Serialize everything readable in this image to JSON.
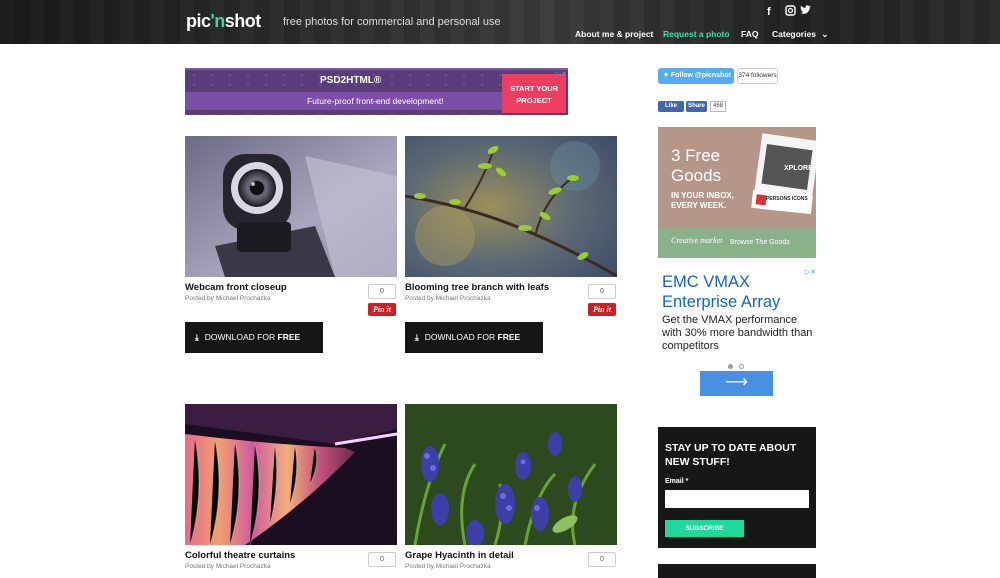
{
  "header": {
    "logo_left": "pic",
    "logo_apos": "'n",
    "logo_right": "shot",
    "tagline": "free photos for commercial and personal use",
    "social": {
      "facebook": "f",
      "instagram": "◘",
      "twitter": "𝕥"
    },
    "nav": [
      {
        "label": "About me & project"
      },
      {
        "label": "Request a photo"
      },
      {
        "label": "FAQ"
      },
      {
        "label": "Categories"
      }
    ],
    "active_color": "#3fe0a8"
  },
  "ad": {
    "brand": "PSD2HTML®",
    "text": "Future-proof front-end development!",
    "cta_line1": "START YOUR",
    "cta_line2": "PROJECT"
  },
  "photos": [
    {
      "title": "Webcam front closeup",
      "by": "Posted by Michael Prochazka",
      "count": "0",
      "pin": "Pin it",
      "download": "DOWNLOAD FOR",
      "download_bold": "FREE"
    },
    {
      "title": "Blooming tree branch with leafs",
      "by": "Posted by Michael Prochazka",
      "count": "0",
      "pin": "Pin it",
      "download": "DOWNLOAD FOR",
      "download_bold": "FREE"
    },
    {
      "title": "Colorful theatre curtains",
      "by": "Posted by Michael Prochazka",
      "count": "0"
    },
    {
      "title": "Grape Hyacinth in detail",
      "by": "Posted by Michael Prochazka",
      "count": "0"
    }
  ],
  "sidebar": {
    "twitter_follow": "Follow @picnshot",
    "twitter_count": "374 followers",
    "fb_like": "Like",
    "fb_share": "Share",
    "fb_count": "468",
    "cm_title_line1": "3 Free",
    "cm_title_line2": "Goods",
    "cm_sub_line1": "IN YOUR INBOX,",
    "cm_sub_line2": "EVERY WEEK.",
    "cm_logo": "Creative market",
    "cm_browse": "Browse The Goods",
    "cm_card1": "XPLORE",
    "cm_card2": "PERSONS ICONS",
    "emc_title": "EMC VMAX Enterprise Array",
    "emc_body": "Get the VMAX performance with 30% more bandwidth than competitors",
    "emc_arrow": "⟶",
    "newsletter_title": "STAY UP TO DATE ABOUT NEW STUFF!",
    "email_label": "Email *",
    "subscribe": "SUBSCRIBE"
  }
}
